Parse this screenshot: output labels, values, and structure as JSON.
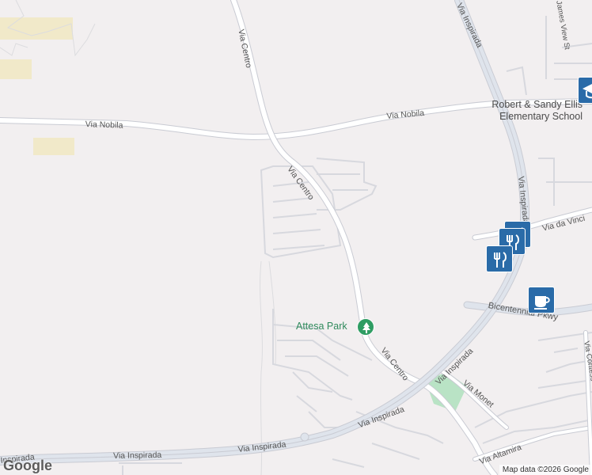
{
  "map": {
    "roads": {
      "via_centro_north": "Via Centro",
      "via_centro_mid": "Via Centro",
      "via_centro_south": "Via Centro",
      "via_nobila_west": "Via Nobila",
      "via_nobila_east": "Via Nobila",
      "via_inspirada_ne": "Via Inspirada",
      "via_inspirada_mid": "Via Inspirada",
      "via_inspirada_diag": "Via Inspirada",
      "via_inspirada_sw": "Via Inspirada",
      "via_inspirada_w": "Via Inspirada",
      "via_inspirada_far_w": "Inspirada",
      "via_da_vinci": "Via da Vinci",
      "bicentennial": "Bicentennial Pkwy",
      "via_monet": "Via Monet",
      "via_altamira": "Via Altamira",
      "james_view": "James View St",
      "via_contessa": "Via Contess"
    },
    "places": {
      "school_line1": "Robert & Sandy Ellis",
      "school_line2": "Elementary School",
      "park": "Attesa Park"
    },
    "pois": [
      {
        "icon": "restaurant-icon"
      },
      {
        "icon": "restaurant-icon"
      },
      {
        "icon": "restaurant-icon"
      },
      {
        "icon": "cafe-icon"
      },
      {
        "icon": "school-icon"
      }
    ],
    "attribution": "Map data ©2026 Google",
    "logo": "Google",
    "colors": {
      "background": "#f2eff0",
      "road": "#ffffff",
      "road_edge": "#c9cbd3",
      "highway_fill": "#dfe4ec",
      "park": "#b9e3c5",
      "sand": "#f1e9c9",
      "poi": "#2a6ba8",
      "park_text": "#2f8a5c"
    }
  }
}
